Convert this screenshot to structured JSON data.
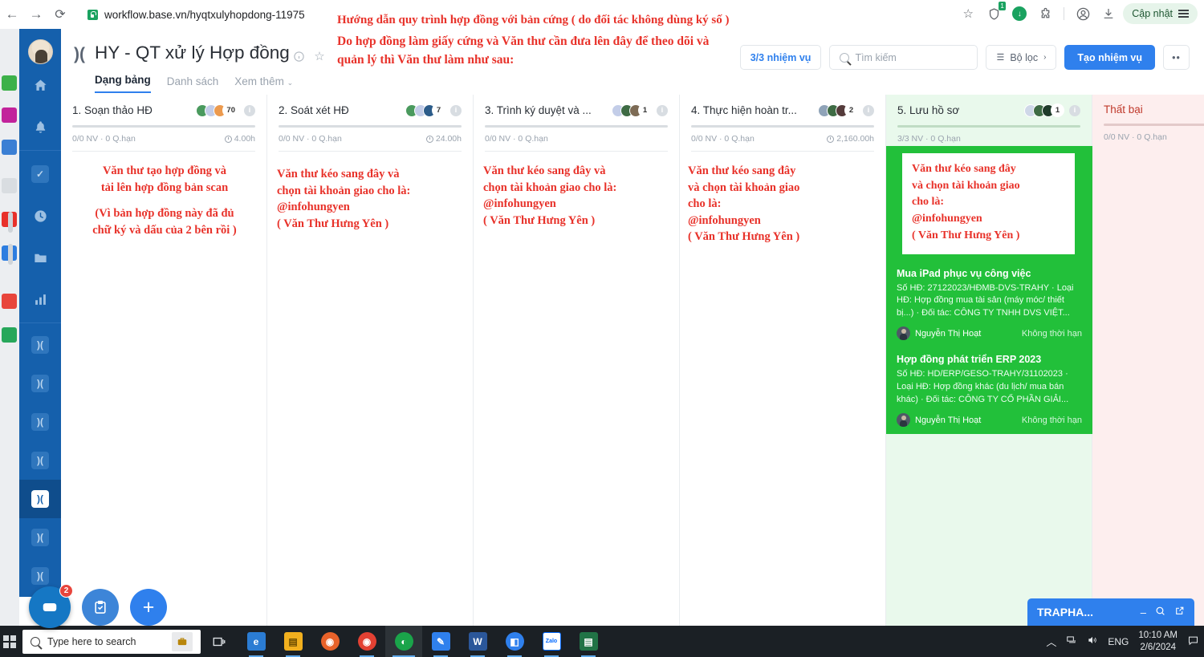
{
  "browser": {
    "url": "workflow.base.vn/hyqtxulyhopdong-11975",
    "back_icon": "back-arrow-icon",
    "forward_icon": "forward-arrow-icon",
    "reload_icon": "reload-icon",
    "lock_icon": "lock-icon",
    "star_icon": "star-icon",
    "extension_icon": "shield-extension-icon",
    "extension_badge": "1",
    "download_icon": "download-icon",
    "puzzle_icon": "puzzle-extensions-icon",
    "profile_icon": "profile-avatar-icon",
    "downloads_tray_icon": "downloads-tray-icon",
    "update_label": "Cập nhật",
    "menu_icon": "hamburger-menu-icon"
  },
  "app": {
    "logo_glyph": ")(",
    "title": "HY - QT xử lý Hợp đồng",
    "info_icon": "info-circle-icon",
    "favorite_icon": "star-outline-icon",
    "tabs": [
      {
        "label": "Dạng bảng",
        "active": true
      },
      {
        "label": "Danh sách",
        "active": false
      },
      {
        "label": "Xem thêm",
        "active": false,
        "chevron": "chevron-down-icon"
      }
    ],
    "toolbar": {
      "task_count": "3/3 nhiệm vụ",
      "search_placeholder": "Tìm kiếm",
      "search_icon": "search-icon",
      "filter_label": "Bộ lọc",
      "filter_icon": "filter-icon",
      "filter_chevron": "chevron-right-icon",
      "create_label": "Tạo nhiệm vụ",
      "more_label": "••"
    }
  },
  "annotations": {
    "header_line1": "Hướng dẫn quy trình hợp đồng với bản cứng ( do đối tác không dùng ký số )",
    "header_line2": "Do hợp đồng làm giấy cứng và Văn thư cần đưa lên đây để theo dõi và",
    "header_line3": "quản lý thì  Văn thư làm như sau:",
    "col1_a1": "Văn thư tạo hợp đồng và",
    "col1_a2": "tải lên hợp đồng bản scan",
    "col1_b1": "(Vì bản hợp đồng này đã đủ",
    "col1_b2": "chữ ký và dấu của 2 bên rồi )",
    "col2_l1": "Văn thư kéo sang đây và",
    "col2_l2": "chọn tài khoản giao cho là:",
    "col2_l3": "@infohungyen",
    "col2_l4": "( Văn Thư Hưng Yên )",
    "col3_l1": "Văn thư kéo sang đây và",
    "col3_l2": "chọn tài khoản giao cho là:",
    "col3_l3": "@infohungyen",
    "col3_l4": "( Văn Thư Hưng Yên )",
    "col4_l1": "Văn thư kéo sang đây",
    "col4_l2": "và chọn tài khoản giao",
    "col4_l3": "cho là:",
    "col4_l4": "@infohungyen",
    "col4_l5": "( Văn Thư Hưng Yên )",
    "col5_l1": "Văn thư kéo sang đây",
    "col5_l2": "và chọn tài khoản giao",
    "col5_l3": "cho là:",
    "col5_l4": "@infohungyen",
    "col5_l5": "( Văn Thư Hưng Yên )"
  },
  "columns": [
    {
      "title": "1. Soạn thảo HĐ",
      "count": "70",
      "meta_left": "0/0 NV · 0 Q.hạn",
      "meta_right": "4.00h",
      "state": "normal"
    },
    {
      "title": "2. Soát xét HĐ",
      "count": "7",
      "meta_left": "0/0 NV · 0 Q.hạn",
      "meta_right": "24.00h",
      "state": "normal"
    },
    {
      "title": "3. Trình ký duyệt và ...",
      "count": "1",
      "meta_left": "0/0 NV · 0 Q.hạn",
      "meta_right": "",
      "state": "normal"
    },
    {
      "title": "4. Thực hiện hoàn tr...",
      "count": "2",
      "meta_left": "0/0 NV · 0 Q.hạn",
      "meta_right": "2,160.00h",
      "state": "normal"
    },
    {
      "title": "5. Lưu hồ sơ",
      "count": "1",
      "meta_left": "3/3 NV · 0 Q.hạn",
      "meta_right": "",
      "state": "green"
    },
    {
      "title": "Thất bại",
      "count": "",
      "meta_left": "0/0 NV · 0 Q.hạn",
      "meta_right": "",
      "state": "red"
    }
  ],
  "cards": [
    {
      "title": "Mua iPad phục vụ công việc",
      "desc": "Số HĐ: 27122023/HĐMB-DVS-TRAHY · Loại HĐ: Hợp đồng mua tài sản (máy móc/ thiết bị...) · Đối tác: CÔNG TY TNHH DVS VIỆT...",
      "assignee": "Nguyễn Thị Hoạt",
      "due": "Không thời hạn"
    },
    {
      "title": "Hợp đồng phát triển ERP 2023",
      "desc": "Số HĐ: HD/ERP/GESO-TRAHY/31102023 · Loại HĐ: Hợp đồng khác (du lịch/ mua bán khác) · Đối tác: CÔNG TY CỔ PHẦN GIẢI...",
      "assignee": "Nguyễn Thị Hoạt",
      "due": "Không thời hạn"
    }
  ],
  "fabs": {
    "chat_icon": "chat-message-icon",
    "chat_badge": "2",
    "task_icon": "clipboard-check-icon",
    "add_icon": "plus-icon"
  },
  "chat_widget": {
    "title": "TRAPHA...",
    "minimize_icon": "minimize-icon",
    "search_icon": "search-icon",
    "expand_icon": "open-new-window-icon"
  },
  "taskbar": {
    "start_icon": "windows-start-icon",
    "search_placeholder": "Type here to search",
    "search_icon": "search-icon",
    "briefcase_icon": "briefcase-icon",
    "taskview_icon": "task-view-icon",
    "apps": [
      {
        "name": "edge-icon",
        "glyph": "e",
        "color": "#2b7cd3"
      },
      {
        "name": "file-explorer-icon",
        "glyph": "▤",
        "color": "#f2b01e"
      },
      {
        "name": "firefox-icon",
        "glyph": "◉",
        "color": "#e8622a"
      },
      {
        "name": "chrome-icon",
        "glyph": "◉",
        "color": "#e34133"
      },
      {
        "name": "base-app-icon",
        "glyph": "◐",
        "color": "#1aa44a"
      },
      {
        "name": "paint-icon",
        "glyph": "✎",
        "color": "#2f80ed"
      },
      {
        "name": "word-icon",
        "glyph": "W",
        "color": "#2b579a"
      },
      {
        "name": "teams-icon",
        "glyph": "◧",
        "color": "#2f80ed"
      },
      {
        "name": "zalo-icon",
        "glyph": "Zalo",
        "color": "#0068ff"
      },
      {
        "name": "excel-icon",
        "glyph": "▤",
        "color": "#217346"
      }
    ],
    "tray": {
      "chevron_icon": "chevron-up-icon",
      "network_icon": "network-icon",
      "volume_icon": "volume-icon",
      "language": "ENG",
      "time": "10:10 AM",
      "date": "2/6/2024",
      "notification_icon": "notification-icon"
    }
  },
  "colors": {
    "accent": "#2f80ed",
    "annotation_red": "#e8322a",
    "green_highlight": "#22c03a",
    "rail_blue": "#1560ac"
  }
}
